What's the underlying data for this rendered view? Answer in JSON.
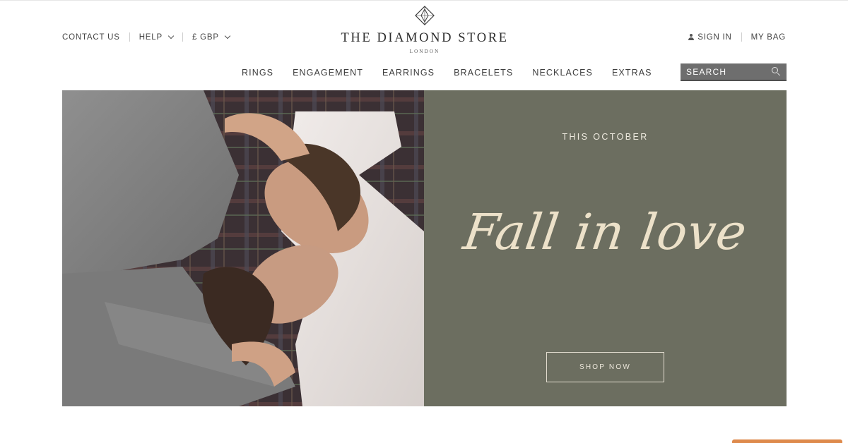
{
  "header": {
    "contact_label": "CONTACT US",
    "help_label": "HELP",
    "currency_label": "£ GBP",
    "sign_in_label": "SIGN IN",
    "bag_label": "MY BAG",
    "brand_name": "THE DIAMOND STORE",
    "brand_sub": "LONDON"
  },
  "nav": {
    "items": [
      "RINGS",
      "ENGAGEMENT",
      "EARRINGS",
      "BRACELETS",
      "NECKLACES",
      "EXTRAS"
    ]
  },
  "search": {
    "placeholder": "SEARCH"
  },
  "hero": {
    "eyebrow": "THIS OCTOBER",
    "headline": "Fall in love",
    "cta_label": "SHOP NOW"
  },
  "colors": {
    "panel": "#6c6e60",
    "headline": "#ece1c9",
    "search_bg": "#6e6e6e",
    "chat_tab": "#de8a4c"
  },
  "icons": [
    "diamond-logo-icon",
    "chevron-down-icon",
    "user-icon",
    "search-icon"
  ]
}
